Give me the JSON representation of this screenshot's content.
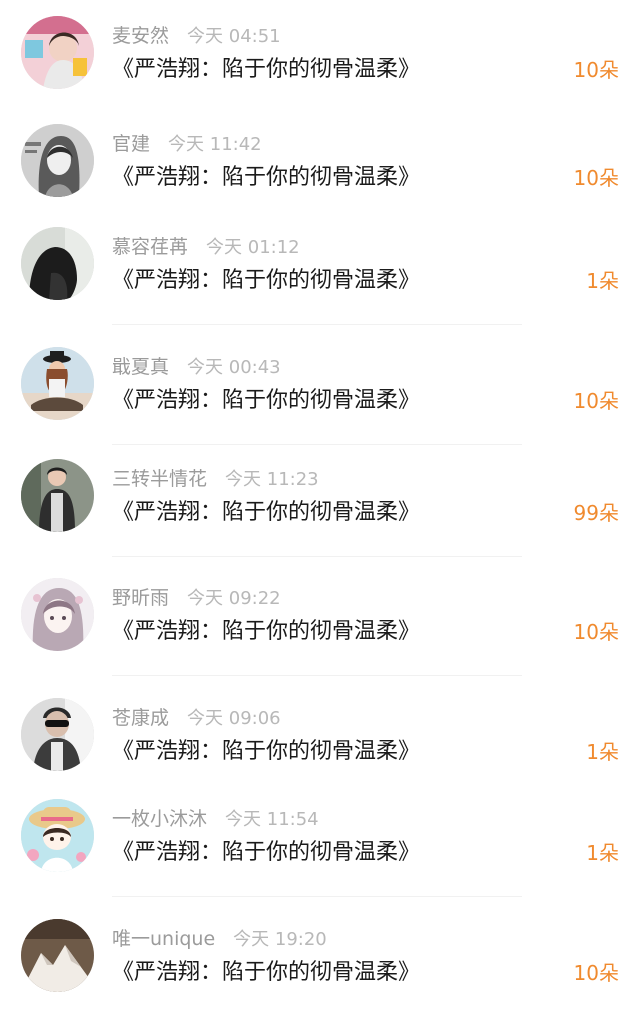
{
  "gift_list": {
    "items": [
      {
        "name": "麦安然",
        "time": "今天 04:51",
        "title": "《严浩翔：陷于你的彻骨温柔》",
        "amount": "10朵",
        "avatar": "user-photo-avatar"
      },
      {
        "name": "官建",
        "time": "今天 11:42",
        "title": "《严浩翔：陷于你的彻骨温柔》",
        "amount": "10朵",
        "avatar": "sketch-illustration-avatar"
      },
      {
        "name": "慕容荏苒",
        "time": "今天 01:12",
        "title": "《严浩翔：陷于你的彻骨温柔》",
        "amount": "1朵",
        "avatar": "dark-silhouette-avatar"
      },
      {
        "name": "戢夏真",
        "time": "今天 00:43",
        "title": "《严浩翔：陷于你的彻骨温柔》",
        "amount": "10朵",
        "avatar": "sitting-person-avatar"
      },
      {
        "name": "三转半情花",
        "time": "今天 11:23",
        "title": "《严浩翔：陷于你的彻骨温柔》",
        "amount": "99朵",
        "avatar": "street-person-avatar"
      },
      {
        "name": "野昕雨",
        "time": "今天 09:22",
        "title": "《严浩翔：陷于你的彻骨温柔》",
        "amount": "10朵",
        "avatar": "anime-girl-avatar"
      },
      {
        "name": "苍康成",
        "time": "今天 09:06",
        "title": "《严浩翔：陷于你的彻骨温柔》",
        "amount": "1朵",
        "avatar": "sunglasses-man-avatar"
      },
      {
        "name": "一枚小沐沐",
        "time": "今天 11:54",
        "title": "《严浩翔：陷于你的彻骨温柔》",
        "amount": "1朵",
        "avatar": "cartoon-girl-avatar"
      },
      {
        "name": "唯一unique",
        "time": "今天 19:20",
        "title": "《严浩翔：陷于你的彻骨温柔》",
        "amount": "10朵",
        "avatar": "snowy-mountain-avatar"
      }
    ]
  },
  "colors": {
    "amount": "#f08a2e",
    "name": "#9b9b9b",
    "time": "#b8b8b8",
    "title": "#1b1b1b"
  }
}
